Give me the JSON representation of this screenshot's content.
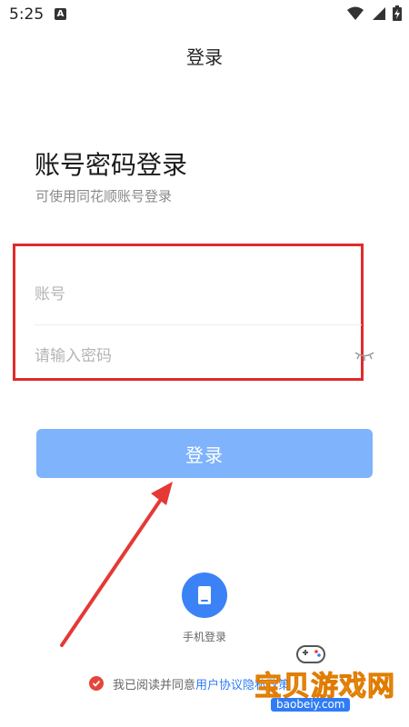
{
  "status_bar": {
    "time": "5:25",
    "notification_icon": "a-badge-icon",
    "wifi_icon": "wifi-icon",
    "signal_icon": "signal-icon",
    "battery_icon": "battery-icon"
  },
  "header": {
    "title": "登录"
  },
  "form": {
    "heading": "账号密码登录",
    "subheading": "可使用同花顺账号登录",
    "account": {
      "value": "",
      "placeholder": "账号"
    },
    "password": {
      "value": "",
      "placeholder": "请输入密码",
      "toggle_icon": "eye-closed-icon"
    },
    "submit_label": "登录"
  },
  "alt_login": {
    "phone_label": "手机登录",
    "phone_icon": "phone-icon"
  },
  "agreement": {
    "text": "我已阅读并同意",
    "link1": "用户协议",
    "link2": "隐私政策"
  },
  "watermark": {
    "text": "宝贝游戏网",
    "url": "baobeiy.com"
  },
  "colors": {
    "primary_button": "#7fb3fb",
    "phone_circle": "#3b82f6",
    "link": "#2f7cf6",
    "annotation_red": "#e02b2b",
    "check_red": "#e5463b"
  }
}
